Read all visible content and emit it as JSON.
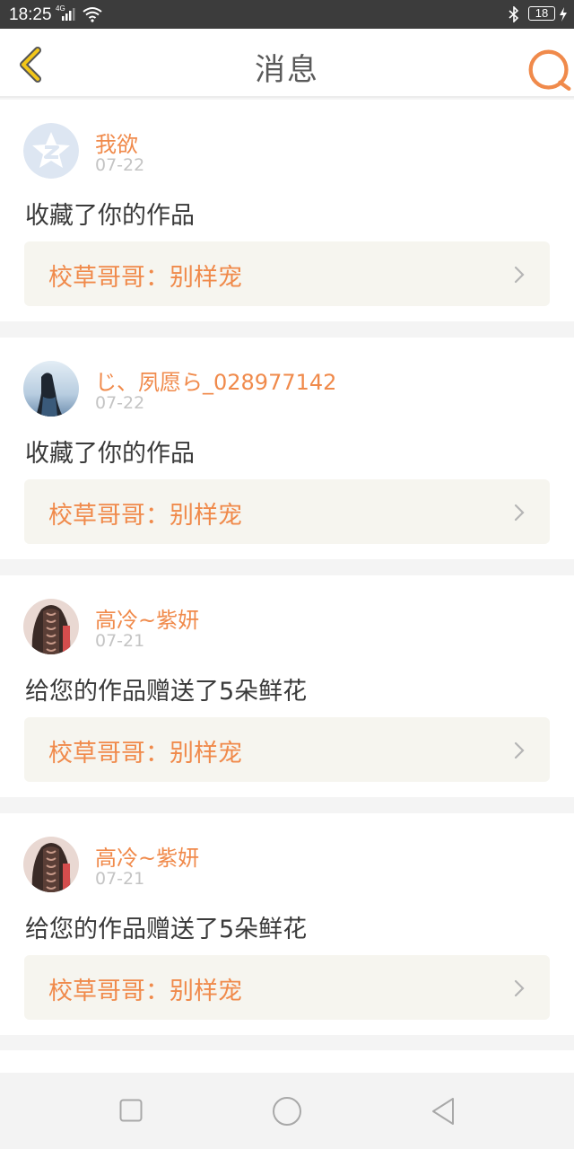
{
  "status_bar": {
    "time": "18:25",
    "network": "4G",
    "battery": "18",
    "icons": [
      "signal-icon",
      "wifi-icon",
      "bluetooth-icon",
      "battery-icon",
      "charging-icon"
    ]
  },
  "header": {
    "title": "消息",
    "back_icon": "chevron-left-icon",
    "message_icon": "chat-bubble-icon"
  },
  "colors": {
    "accent": "#f08a4b",
    "back_yellow": "#f2c619",
    "work_bg": "#f6f5ef",
    "text": "#3a3a3a",
    "date": "#c4c4c4"
  },
  "messages": [
    {
      "name": "我欲",
      "date": "07-22",
      "action": "收藏了你的作品",
      "work": "校草哥哥：别样宠",
      "avatar": "qq-default-avatar"
    },
    {
      "name": "じ、夙愿ら_028977142",
      "date": "07-22",
      "action": "收藏了你的作品",
      "work": "校草哥哥：别样宠",
      "avatar": "girl-photo-avatar"
    },
    {
      "name": "高冷~紫妍",
      "date": "07-21",
      "action": "给您的作品赠送了5朵鲜花",
      "work": "校草哥哥：别样宠",
      "avatar": "braid-photo-avatar"
    },
    {
      "name": "高冷~紫妍",
      "date": "07-21",
      "action": "给您的作品赠送了5朵鲜花",
      "work": "校草哥哥：别样宠",
      "avatar": "braid-photo-avatar"
    }
  ],
  "nav_bar": {
    "icons": [
      "recent-apps-icon",
      "home-icon",
      "back-icon"
    ]
  }
}
